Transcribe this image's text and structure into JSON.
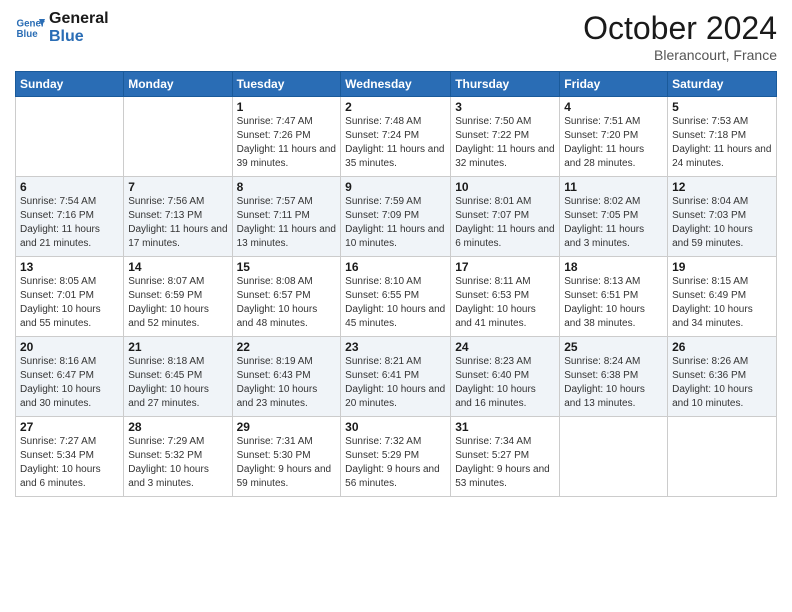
{
  "logo": {
    "line1": "General",
    "line2": "Blue"
  },
  "header": {
    "month": "October 2024",
    "location": "Blerancourt, France"
  },
  "weekdays": [
    "Sunday",
    "Monday",
    "Tuesday",
    "Wednesday",
    "Thursday",
    "Friday",
    "Saturday"
  ],
  "weeks": [
    [
      {
        "day": "",
        "info": ""
      },
      {
        "day": "",
        "info": ""
      },
      {
        "day": "1",
        "info": "Sunrise: 7:47 AM\nSunset: 7:26 PM\nDaylight: 11 hours and 39 minutes."
      },
      {
        "day": "2",
        "info": "Sunrise: 7:48 AM\nSunset: 7:24 PM\nDaylight: 11 hours and 35 minutes."
      },
      {
        "day": "3",
        "info": "Sunrise: 7:50 AM\nSunset: 7:22 PM\nDaylight: 11 hours and 32 minutes."
      },
      {
        "day": "4",
        "info": "Sunrise: 7:51 AM\nSunset: 7:20 PM\nDaylight: 11 hours and 28 minutes."
      },
      {
        "day": "5",
        "info": "Sunrise: 7:53 AM\nSunset: 7:18 PM\nDaylight: 11 hours and 24 minutes."
      }
    ],
    [
      {
        "day": "6",
        "info": "Sunrise: 7:54 AM\nSunset: 7:16 PM\nDaylight: 11 hours and 21 minutes."
      },
      {
        "day": "7",
        "info": "Sunrise: 7:56 AM\nSunset: 7:13 PM\nDaylight: 11 hours and 17 minutes."
      },
      {
        "day": "8",
        "info": "Sunrise: 7:57 AM\nSunset: 7:11 PM\nDaylight: 11 hours and 13 minutes."
      },
      {
        "day": "9",
        "info": "Sunrise: 7:59 AM\nSunset: 7:09 PM\nDaylight: 11 hours and 10 minutes."
      },
      {
        "day": "10",
        "info": "Sunrise: 8:01 AM\nSunset: 7:07 PM\nDaylight: 11 hours and 6 minutes."
      },
      {
        "day": "11",
        "info": "Sunrise: 8:02 AM\nSunset: 7:05 PM\nDaylight: 11 hours and 3 minutes."
      },
      {
        "day": "12",
        "info": "Sunrise: 8:04 AM\nSunset: 7:03 PM\nDaylight: 10 hours and 59 minutes."
      }
    ],
    [
      {
        "day": "13",
        "info": "Sunrise: 8:05 AM\nSunset: 7:01 PM\nDaylight: 10 hours and 55 minutes."
      },
      {
        "day": "14",
        "info": "Sunrise: 8:07 AM\nSunset: 6:59 PM\nDaylight: 10 hours and 52 minutes."
      },
      {
        "day": "15",
        "info": "Sunrise: 8:08 AM\nSunset: 6:57 PM\nDaylight: 10 hours and 48 minutes."
      },
      {
        "day": "16",
        "info": "Sunrise: 8:10 AM\nSunset: 6:55 PM\nDaylight: 10 hours and 45 minutes."
      },
      {
        "day": "17",
        "info": "Sunrise: 8:11 AM\nSunset: 6:53 PM\nDaylight: 10 hours and 41 minutes."
      },
      {
        "day": "18",
        "info": "Sunrise: 8:13 AM\nSunset: 6:51 PM\nDaylight: 10 hours and 38 minutes."
      },
      {
        "day": "19",
        "info": "Sunrise: 8:15 AM\nSunset: 6:49 PM\nDaylight: 10 hours and 34 minutes."
      }
    ],
    [
      {
        "day": "20",
        "info": "Sunrise: 8:16 AM\nSunset: 6:47 PM\nDaylight: 10 hours and 30 minutes."
      },
      {
        "day": "21",
        "info": "Sunrise: 8:18 AM\nSunset: 6:45 PM\nDaylight: 10 hours and 27 minutes."
      },
      {
        "day": "22",
        "info": "Sunrise: 8:19 AM\nSunset: 6:43 PM\nDaylight: 10 hours and 23 minutes."
      },
      {
        "day": "23",
        "info": "Sunrise: 8:21 AM\nSunset: 6:41 PM\nDaylight: 10 hours and 20 minutes."
      },
      {
        "day": "24",
        "info": "Sunrise: 8:23 AM\nSunset: 6:40 PM\nDaylight: 10 hours and 16 minutes."
      },
      {
        "day": "25",
        "info": "Sunrise: 8:24 AM\nSunset: 6:38 PM\nDaylight: 10 hours and 13 minutes."
      },
      {
        "day": "26",
        "info": "Sunrise: 8:26 AM\nSunset: 6:36 PM\nDaylight: 10 hours and 10 minutes."
      }
    ],
    [
      {
        "day": "27",
        "info": "Sunrise: 7:27 AM\nSunset: 5:34 PM\nDaylight: 10 hours and 6 minutes."
      },
      {
        "day": "28",
        "info": "Sunrise: 7:29 AM\nSunset: 5:32 PM\nDaylight: 10 hours and 3 minutes."
      },
      {
        "day": "29",
        "info": "Sunrise: 7:31 AM\nSunset: 5:30 PM\nDaylight: 9 hours and 59 minutes."
      },
      {
        "day": "30",
        "info": "Sunrise: 7:32 AM\nSunset: 5:29 PM\nDaylight: 9 hours and 56 minutes."
      },
      {
        "day": "31",
        "info": "Sunrise: 7:34 AM\nSunset: 5:27 PM\nDaylight: 9 hours and 53 minutes."
      },
      {
        "day": "",
        "info": ""
      },
      {
        "day": "",
        "info": ""
      }
    ]
  ]
}
